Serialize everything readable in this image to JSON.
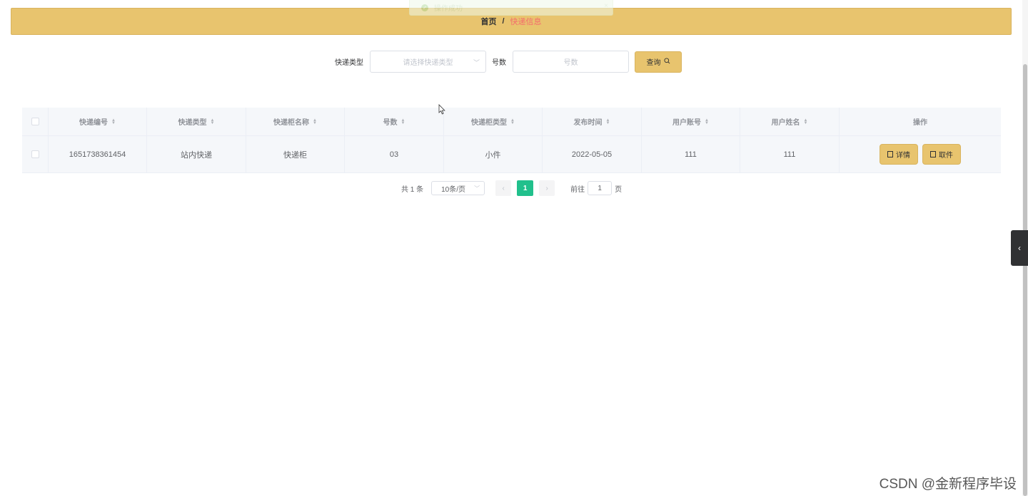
{
  "toast": {
    "message": "操作成功",
    "close": "×"
  },
  "breadcrumb": {
    "home": "首页",
    "separator": "/",
    "current": "快递信息"
  },
  "search": {
    "type_label": "快递类型",
    "type_placeholder": "请选择快递类型",
    "number_label": "号数",
    "number_placeholder": "号数",
    "query_button": "查询"
  },
  "table": {
    "columns": [
      "快递编号",
      "快递类型",
      "快递柜名称",
      "号数",
      "快递柜类型",
      "发布时间",
      "用户账号",
      "用户姓名",
      "操作"
    ],
    "rows": [
      [
        "1651738361454",
        "站内快递",
        "快递柜",
        "03",
        "小件",
        "2022-05-05",
        "111",
        "111"
      ]
    ],
    "actions": {
      "detail": "详情",
      "pickup": "取件"
    }
  },
  "pagination": {
    "total_text": "共 1 条",
    "page_size": "10条/页",
    "prev": "‹",
    "current_page": "1",
    "next": "›",
    "goto_label": "前往",
    "goto_value": "1",
    "goto_suffix": "页"
  },
  "side_tab": {
    "icon": "‹"
  },
  "watermark": "CSDN @金新程序毕设"
}
